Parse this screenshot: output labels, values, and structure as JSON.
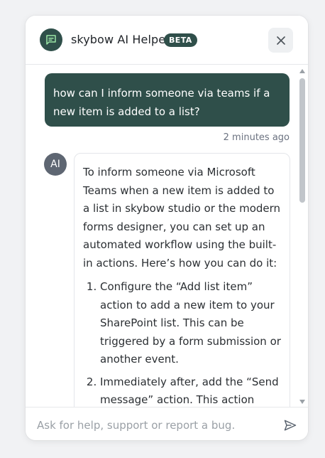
{
  "header": {
    "title": "skybow AI Helper",
    "badge": "BETA",
    "logo_icon": "chat-bubble-icon",
    "close_icon": "close-icon"
  },
  "colors": {
    "brand": "#2f4f4a",
    "avatar_bg": "#5e6672"
  },
  "conversation": {
    "user_message": "how can I inform someone via teams if a new item is added to a list?",
    "timestamp": "2 minutes ago",
    "ai_avatar_label": "AI",
    "ai_intro": "To inform someone via Microsoft Teams when a new item is added to a list in skybow studio or the modern forms designer, you can set up an automated workflow using the built-in actions. Here’s how you can do it:",
    "ai_steps": [
      "Configure the “Add list item” action to add a new item to your SharePoint list. This can be triggered by a form submission or another event.",
      "Immediately after, add the “Send message” action. This action allows"
    ]
  },
  "composer": {
    "placeholder": "Ask for help, support or report a bug.",
    "value": "",
    "send_icon": "send-icon"
  }
}
